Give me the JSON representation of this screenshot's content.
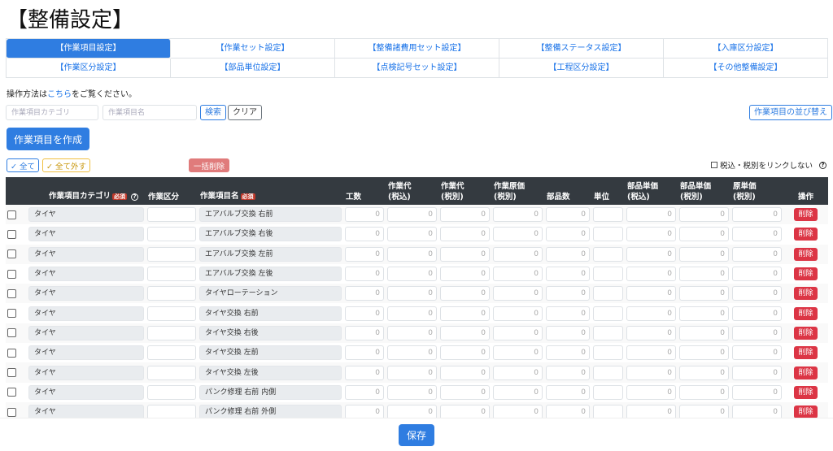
{
  "title": "【整備設定】",
  "tabs": [
    {
      "label": "【作業項目設定】",
      "active": true
    },
    {
      "label": "【作業セット設定】"
    },
    {
      "label": "【整備諸費用セット設定】"
    },
    {
      "label": "【整備ステータス設定】"
    },
    {
      "label": "【入庫区分設定】"
    },
    {
      "label": "【作業区分設定】"
    },
    {
      "label": "【部品単位設定】"
    },
    {
      "label": "【点検記号セット設定】"
    },
    {
      "label": "【工程区分設定】"
    },
    {
      "label": "【その他整備設定】"
    }
  ],
  "instruction": {
    "prefix": "操作方法は",
    "link": "こちら",
    "suffix": "をご覧ください。"
  },
  "filters": {
    "category_placeholder": "作業項目カテゴリ",
    "name_placeholder": "作業項目名",
    "search_label": "検索",
    "clear_label": "クリア",
    "sort_label": "作業項目の並び替え"
  },
  "create_label": "作業項目を作成",
  "select_all_label": "全て",
  "deselect_all_label": "全て外す",
  "bulk_delete_label": "一括削除",
  "tax_link_label": "税込・税別をリンクしない",
  "table": {
    "headers": {
      "category": "作業項目カテゴリ",
      "required": "必須",
      "division": "作業区分",
      "name": "作業項目名",
      "hours": "工数",
      "fee_incl_1": "作業代",
      "fee_incl_2": "(税込)",
      "fee_excl_1": "作業代",
      "fee_excl_2": "(税別)",
      "cost_1": "作業原価",
      "cost_2": "(税別)",
      "parts_count": "部品数",
      "unit": "単位",
      "parts_price_incl_1": "部品単価",
      "parts_price_incl_2": "(税込)",
      "parts_price_excl_1": "部品単価",
      "parts_price_excl_2": "(税別)",
      "unit_cost_1": "原単価",
      "unit_cost_2": "(税別)",
      "actions": "操作"
    },
    "zero": "0",
    "delete_label": "削除",
    "rows": [
      {
        "category": "タイヤ",
        "name": "エアバルブ交換 右前"
      },
      {
        "category": "タイヤ",
        "name": "エアバルブ交換 右後"
      },
      {
        "category": "タイヤ",
        "name": "エアバルブ交換 左前"
      },
      {
        "category": "タイヤ",
        "name": "エアバルブ交換 左後"
      },
      {
        "category": "タイヤ",
        "name": "タイヤローテーション"
      },
      {
        "category": "タイヤ",
        "name": "タイヤ交換 右前"
      },
      {
        "category": "タイヤ",
        "name": "タイヤ交換 右後"
      },
      {
        "category": "タイヤ",
        "name": "タイヤ交換 左前"
      },
      {
        "category": "タイヤ",
        "name": "タイヤ交換 左後"
      },
      {
        "category": "タイヤ",
        "name": "パンク修理 右前 内側"
      },
      {
        "category": "タイヤ",
        "name": "パンク修理 右前 外側"
      }
    ]
  },
  "save_label": "保存"
}
